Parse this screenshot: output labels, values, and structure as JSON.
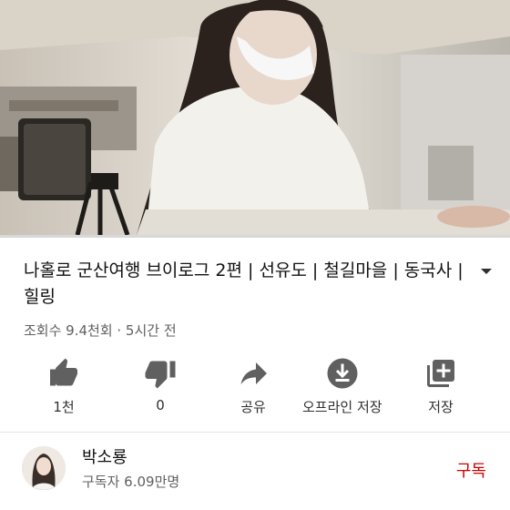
{
  "video": {
    "title": "나홀로 군산여행 브이로그 2편 | 선유도 | 철길마을 | 동국사 | 힐링",
    "meta": "조회수 9.4천회 · 5시간 전",
    "progress": 0.0
  },
  "actions": [
    {
      "icon": "thumbs-up-icon",
      "label": "1천"
    },
    {
      "icon": "thumbs-down-icon",
      "label": "0"
    },
    {
      "icon": "share-icon",
      "label": "공유"
    },
    {
      "icon": "download-icon",
      "label": "오프라인 저장"
    },
    {
      "icon": "add-to-playlist-icon",
      "label": "저장"
    }
  ],
  "channel": {
    "name": "박소룡",
    "subscribers": "구독자 6.09만명",
    "subscribe_label": "구독"
  },
  "colors": {
    "accent": "#cc0000",
    "progress": "#ff0000",
    "icon": "#606060"
  }
}
